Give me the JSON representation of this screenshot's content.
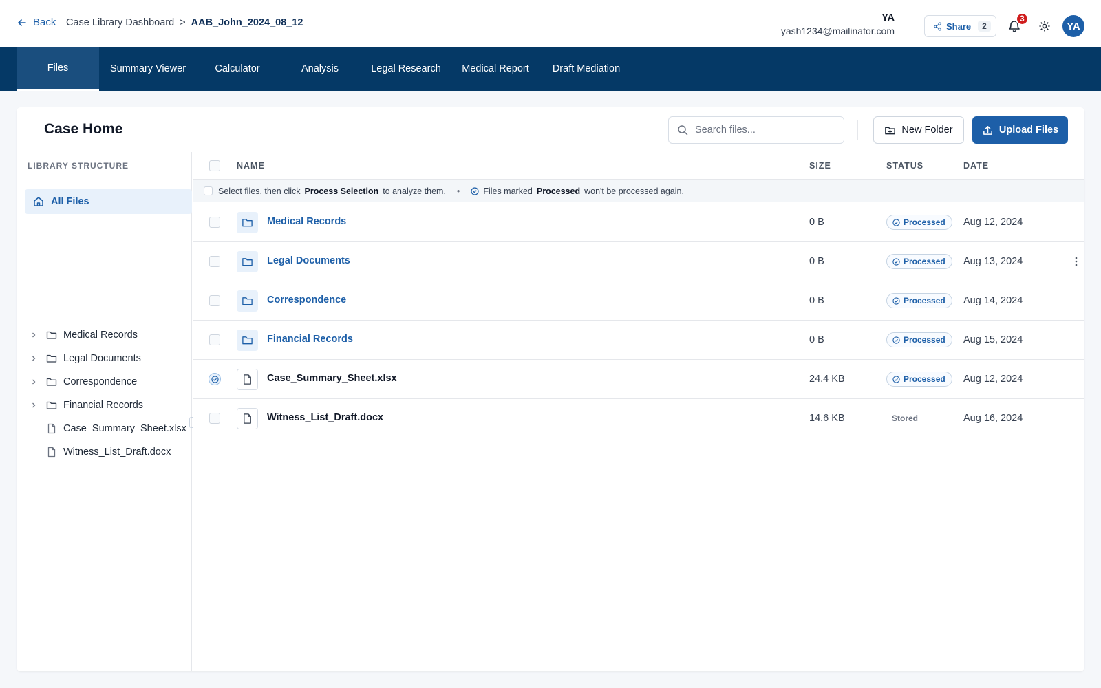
{
  "header": {
    "back_label": "Back",
    "breadcrumb": [
      "Case Library Dashboard",
      "AAB_John_2024_08_12"
    ],
    "breadcrumb_sep": ">",
    "user_initials": "YA",
    "user_email": "yash1234@mailinator.com",
    "share_label": "Share",
    "share_count": "2",
    "notification_count": "3",
    "avatar_initials": "YA"
  },
  "nav": {
    "tabs": [
      {
        "label": "Files",
        "active": true
      },
      {
        "label": "Summary Viewer",
        "active": false
      },
      {
        "label": "Calculator",
        "active": false
      },
      {
        "label": "Analysis",
        "active": false
      },
      {
        "label": "Legal Research",
        "active": false
      },
      {
        "label": "Medical Report",
        "active": false
      },
      {
        "label": "Draft Mediation",
        "active": false
      }
    ]
  },
  "main": {
    "title": "Case Home",
    "search_placeholder": "Search files...",
    "new_folder_label": "New Folder",
    "upload_label": "Upload Files"
  },
  "sidebar": {
    "heading": "LIBRARY STRUCTURE",
    "all_files_label": "All Files",
    "items": [
      {
        "label": "Medical Records",
        "type": "folder"
      },
      {
        "label": "Legal Documents",
        "type": "folder"
      },
      {
        "label": "Correspondence",
        "type": "folder"
      },
      {
        "label": "Financial Records",
        "type": "folder"
      },
      {
        "label": "Case_Summary_Sheet.xlsx",
        "type": "file"
      },
      {
        "label": "Witness_List_Draft.docx",
        "type": "file"
      }
    ]
  },
  "table": {
    "columns": {
      "name": "NAME",
      "size": "SIZE",
      "status": "STATUS",
      "date": "DATE"
    },
    "hint": {
      "part1": "Select files, then click",
      "bold1": "Process Selection",
      "part2": "to analyze them.",
      "dot": "•",
      "part3": "Files marked",
      "bold2": "Processed",
      "part4": "won't be processed again."
    },
    "rows": [
      {
        "name": "Medical Records",
        "type": "folder",
        "size": "0 B",
        "status": "Processed",
        "date": "Aug 12, 2024"
      },
      {
        "name": "Legal Documents",
        "type": "folder",
        "size": "0 B",
        "status": "Processed",
        "date": "Aug 13, 2024"
      },
      {
        "name": "Correspondence",
        "type": "folder",
        "size": "0 B",
        "status": "Processed",
        "date": "Aug 14, 2024"
      },
      {
        "name": "Financial Records",
        "type": "folder",
        "size": "0 B",
        "status": "Processed",
        "date": "Aug 15, 2024"
      },
      {
        "name": "Case_Summary_Sheet.xlsx",
        "type": "file",
        "size": "24.4 KB",
        "status": "Processed",
        "date": "Aug 12, 2024"
      },
      {
        "name": "Witness_List_Draft.docx",
        "type": "file",
        "size": "14.6 KB",
        "status": "Stored",
        "date": "Aug 16, 2024"
      }
    ]
  },
  "colors": {
    "primary": "#1d5fa8",
    "nav_bg": "#053966",
    "nav_active": "#1a4e7e",
    "badge_red": "#d01d1d"
  }
}
